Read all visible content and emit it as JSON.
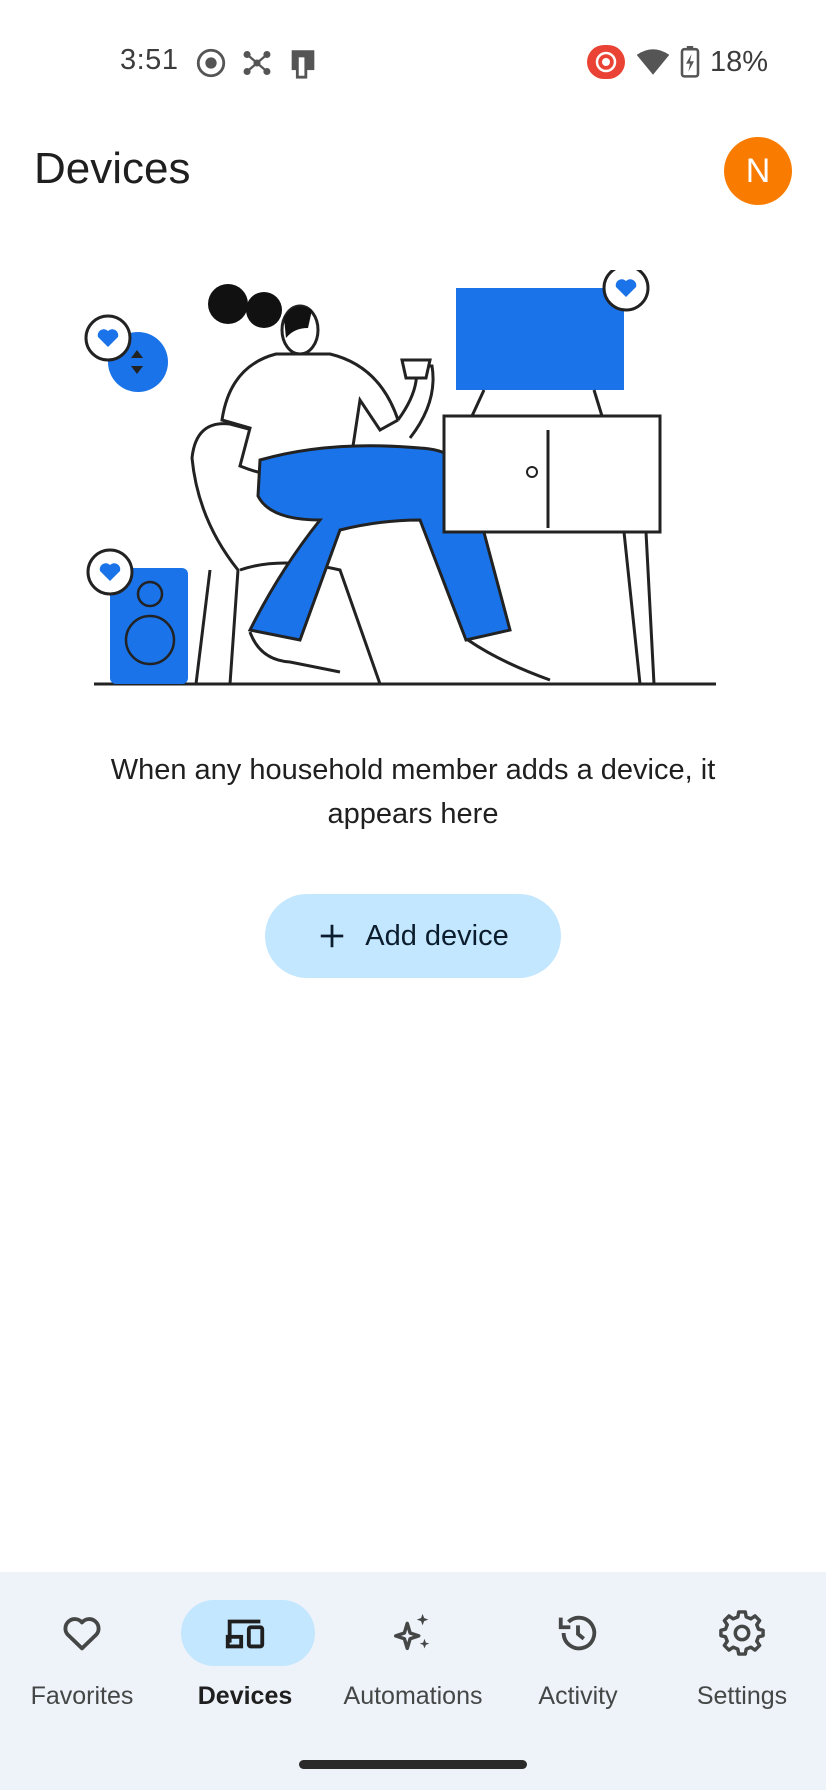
{
  "status_bar": {
    "time": "3:51",
    "battery_percent": "18%",
    "icons": [
      "screen-record-icon",
      "nodes-icon",
      "device-icon",
      "cast-recording-icon",
      "wifi-icon",
      "battery-charging-icon"
    ]
  },
  "header": {
    "title": "Devices",
    "avatar_initial": "N",
    "avatar_color": "#f97c00"
  },
  "empty_state": {
    "message": "When any household member adds a device, it appears here",
    "add_button_label": "Add device",
    "accent_color": "#1a73e8"
  },
  "bottom_nav": {
    "items": [
      {
        "label": "Favorites",
        "icon": "heart-icon",
        "active": false
      },
      {
        "label": "Devices",
        "icon": "devices-icon",
        "active": true
      },
      {
        "label": "Automations",
        "icon": "sparkle-icon",
        "active": false
      },
      {
        "label": "Activity",
        "icon": "history-icon",
        "active": false
      },
      {
        "label": "Settings",
        "icon": "gear-icon",
        "active": false
      }
    ]
  }
}
